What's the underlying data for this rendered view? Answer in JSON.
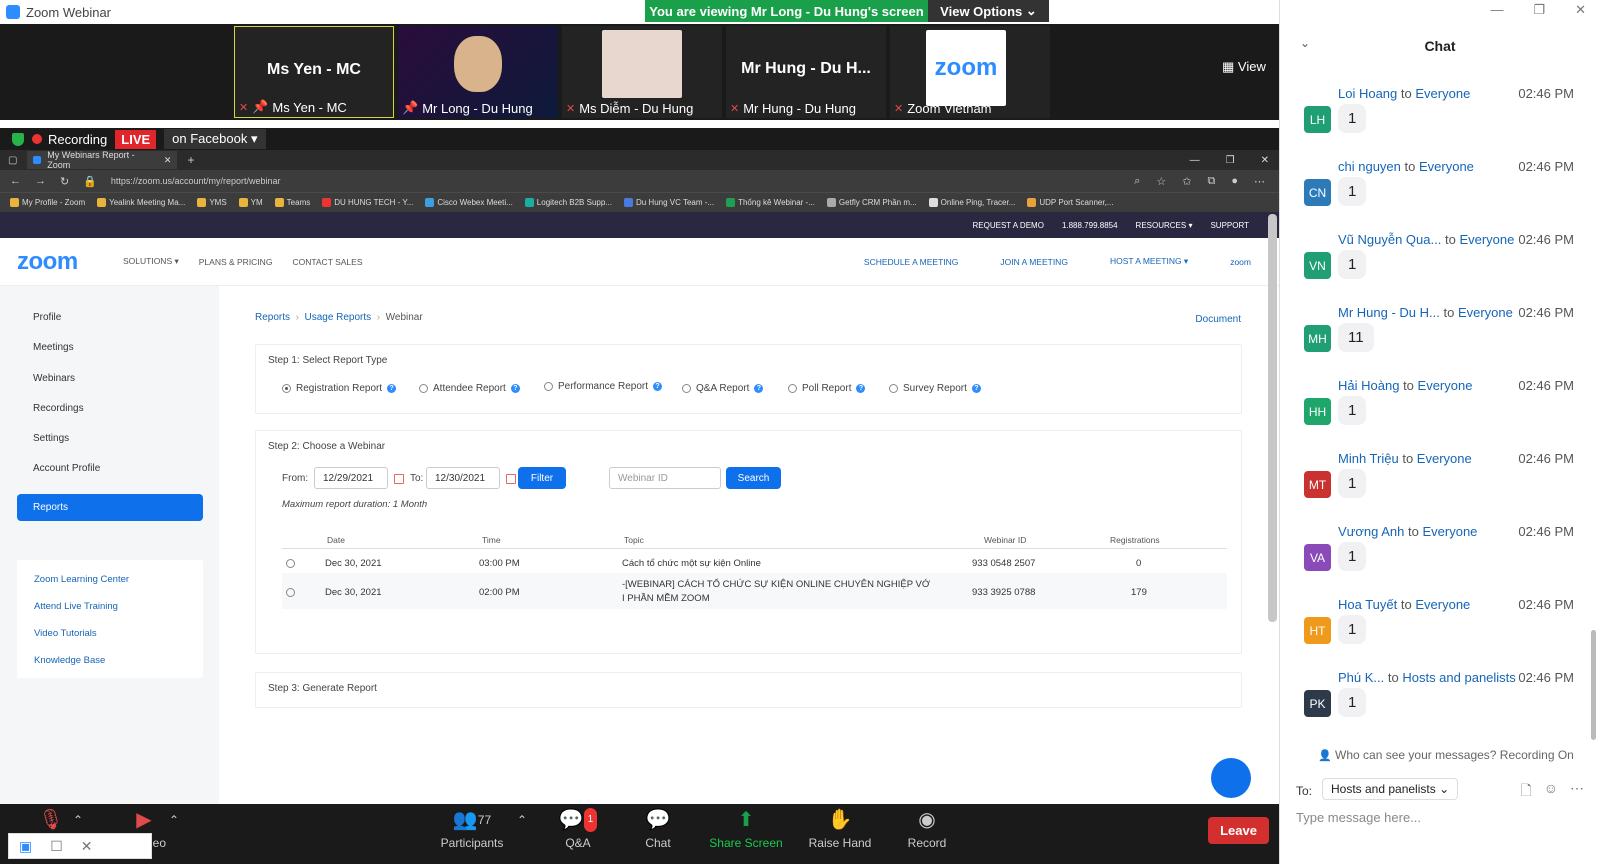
{
  "window": {
    "title": "Zoom Webinar",
    "viewing_banner": "You are viewing Mr Long - Du Hung's screen",
    "view_options": "View Options"
  },
  "video": {
    "view_label": "View",
    "tiles": [
      {
        "big": "Ms Yen - MC",
        "name": "Ms Yen - MC"
      },
      {
        "big": "",
        "name": "Mr Long - Du Hung"
      },
      {
        "big": "",
        "name": "Ms Diễm - Du Hung"
      },
      {
        "big": "Mr Hung - Du H...",
        "name": "Mr Hung - Du Hung"
      },
      {
        "big": "",
        "name": "Zoom Vietnam",
        "logo": "zoom"
      }
    ]
  },
  "recording": {
    "label": "Recording",
    "live": "LIVE",
    "target": "on Facebook"
  },
  "browser": {
    "tab_title": "My Webinars Report - Zoom",
    "url": "https://zoom.us/account/my/report/webinar",
    "bookmarks": [
      "My Profile - Zoom",
      "Yealink Meeting Ma...",
      "YMS",
      "YM",
      "Teams",
      "DU HUNG TECH - Y...",
      "Cisco Webex Meeti...",
      "Logitech B2B Supp...",
      "Du Hung VC Team -...",
      "Thống kê Webinar -...",
      "Getfly CRM Phần m...",
      "Online Ping, Tracer...",
      "UDP Port Scanner,..."
    ]
  },
  "site": {
    "topnav": [
      "REQUEST A DEMO",
      "1.888.799.8854",
      "RESOURCES ▾",
      "SUPPORT"
    ],
    "logo": "zoom",
    "mainnav": [
      "SOLUTIONS ▾",
      "PLANS & PRICING",
      "CONTACT SALES"
    ],
    "mainnav_right": [
      "SCHEDULE A MEETING",
      "JOIN A MEETING",
      "HOST A MEETING ▾",
      "zoom"
    ],
    "sidebar": [
      "Profile",
      "Meetings",
      "Webinars",
      "Recordings",
      "Settings",
      "Account Profile"
    ],
    "sidebar_active": "Reports",
    "sidebar_links": [
      "Zoom Learning Center",
      "Attend Live Training",
      "Video Tutorials",
      "Knowledge Base"
    ],
    "crumbs": [
      "Reports",
      "Usage Reports",
      "Webinar"
    ],
    "docs": "Document",
    "step1": {
      "title": "Step 1: Select Report Type",
      "options": [
        "Registration Report",
        "Attendee Report",
        "Performance Report",
        "Q&A Report",
        "Poll Report",
        "Survey Report"
      ]
    },
    "step2": {
      "title": "Step 2: Choose a Webinar",
      "from_label": "From:",
      "from": "12/29/2021",
      "to_label": "To:",
      "to": "12/30/2021",
      "filter": "Filter",
      "webinar_id_placeholder": "Webinar ID",
      "search": "Search",
      "max_note": "Maximum report duration: 1 Month",
      "headers": [
        "Date",
        "Time",
        "Topic",
        "Webinar ID",
        "Registrations"
      ],
      "rows": [
        {
          "date": "Dec 30, 2021",
          "time": "03:00 PM",
          "topic": "Cách tổ chức một sự kiện Online",
          "topic2": "",
          "id": "933 0548 2507",
          "reg": "0"
        },
        {
          "date": "Dec 30, 2021",
          "time": "02:00 PM",
          "topic": "-[WEBINAR] CÁCH TỔ CHỨC SỰ KIỆN ONLINE CHUYÊN NGHIỆP VỚ",
          "topic2": "I PHẦN MỀM ZOOM",
          "id": "933 3925 0788",
          "reg": "179"
        }
      ]
    },
    "step3": {
      "title": "Step 3: Generate Report"
    }
  },
  "toolbar": {
    "participants_count": "77",
    "participants": "Participants",
    "qa_badge": "1",
    "qa": "Q&A",
    "chat": "Chat",
    "share": "Share Screen",
    "raise": "Raise Hand",
    "record": "Record",
    "leave": "Leave",
    "video_partial": "deo"
  },
  "chat": {
    "title": "Chat",
    "to_word": "to",
    "messages": [
      {
        "initials": "LH",
        "color": "#1f9f73",
        "from": "Loi Hoang",
        "to": "Everyone",
        "time": "02:46 PM",
        "text": "1"
      },
      {
        "initials": "CN",
        "color": "#2d7ab8",
        "from": "chi nguyen",
        "to": "Everyone",
        "time": "02:46 PM",
        "text": "1"
      },
      {
        "initials": "VN",
        "color": "#1f9f73",
        "from": "Vũ Nguyễn Qua...",
        "to": "Everyone",
        "time": "02:46 PM",
        "text": "1"
      },
      {
        "initials": "MH",
        "color": "#1f9f73",
        "from": "Mr Hung - Du H...",
        "to": "Everyone",
        "time": "02:46 PM",
        "text": "11"
      },
      {
        "initials": "HH",
        "color": "#1fa76b",
        "from": "Hải Hoàng",
        "to": "Everyone",
        "time": "02:46 PM",
        "text": "1"
      },
      {
        "initials": "MT",
        "color": "#c9322f",
        "from": "Minh Triệu",
        "to": "Everyone",
        "time": "02:46 PM",
        "text": "1"
      },
      {
        "initials": "VA",
        "color": "#8a4bb8",
        "from": "Vương Anh",
        "to": "Everyone",
        "time": "02:46 PM",
        "text": "1"
      },
      {
        "initials": "HT",
        "color": "#f09a1b",
        "from": "Hoa Tuyết",
        "to": "Everyone",
        "time": "02:46 PM",
        "text": "1"
      },
      {
        "initials": "PK",
        "color": "#2d3a4a",
        "from": "Phú K...",
        "to": "Hosts and panelists",
        "time": "02:46 PM",
        "text": "1"
      }
    ],
    "who_can_see": "Who can see your messages? Recording On",
    "to_label": "To:",
    "to_value": "Hosts and panelists",
    "input_placeholder": "Type message here..."
  }
}
